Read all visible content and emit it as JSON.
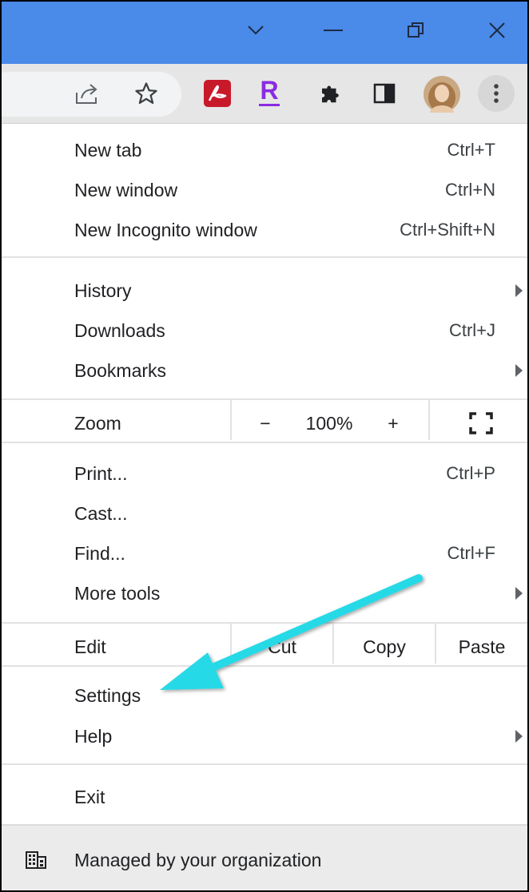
{
  "colors": {
    "titlebar": "#4a8ae8",
    "arrow_annotation": "#26d9e6",
    "acrobat_red": "#c8192b",
    "r_purple": "#8a2be2"
  },
  "titlebar": {
    "icons": [
      "chevron-down-icon",
      "minimize-icon",
      "restore-icon",
      "close-icon"
    ]
  },
  "toolbar": {
    "icons": [
      "share-icon",
      "bookmark-star-icon",
      "acrobat-extension-icon",
      "r-extension-icon",
      "extensions-puzzle-icon",
      "side-panel-icon",
      "profile-avatar",
      "more-vert-icon"
    ],
    "r_letter": "R"
  },
  "menu": {
    "new_tab": {
      "label": "New tab",
      "shortcut": "Ctrl+T"
    },
    "new_window": {
      "label": "New window",
      "shortcut": "Ctrl+N"
    },
    "new_incognito": {
      "label": "New Incognito window",
      "shortcut": "Ctrl+Shift+N"
    },
    "history": {
      "label": "History"
    },
    "downloads": {
      "label": "Downloads",
      "shortcut": "Ctrl+J"
    },
    "bookmarks": {
      "label": "Bookmarks"
    },
    "zoom": {
      "label": "Zoom",
      "minus": "−",
      "value": "100%",
      "plus": "+"
    },
    "print": {
      "label": "Print...",
      "shortcut": "Ctrl+P"
    },
    "cast": {
      "label": "Cast..."
    },
    "find": {
      "label": "Find...",
      "shortcut": "Ctrl+F"
    },
    "more_tools": {
      "label": "More tools"
    },
    "edit": {
      "label": "Edit",
      "cut": "Cut",
      "copy": "Copy",
      "paste": "Paste"
    },
    "settings": {
      "label": "Settings"
    },
    "help": {
      "label": "Help"
    },
    "exit": {
      "label": "Exit"
    },
    "managed": {
      "label": "Managed by your organization"
    }
  }
}
